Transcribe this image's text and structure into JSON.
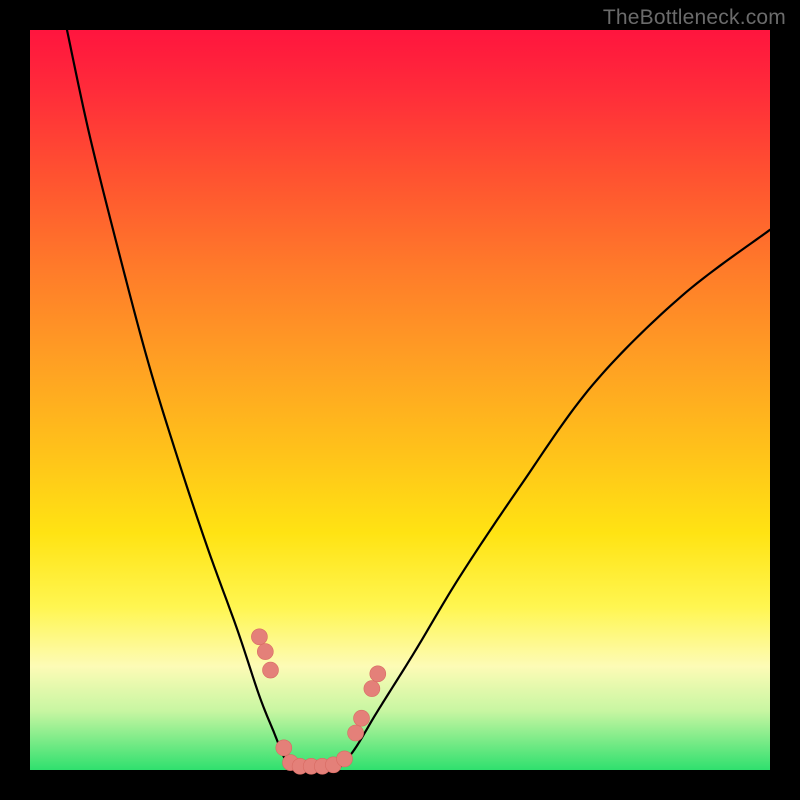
{
  "watermark": "TheBottleneck.com",
  "chart_data": {
    "type": "line",
    "title": "",
    "xlabel": "",
    "ylabel": "",
    "xlim": [
      0,
      100
    ],
    "ylim": [
      0,
      100
    ],
    "grid": false,
    "legend": false,
    "background_gradient": {
      "direction": "vertical",
      "stops": [
        {
          "pos": 0.0,
          "color": "#ff153e"
        },
        {
          "pos": 0.45,
          "color": "#ffa023"
        },
        {
          "pos": 0.78,
          "color": "#fff651"
        },
        {
          "pos": 1.0,
          "color": "#2fe06e"
        }
      ]
    },
    "series": [
      {
        "name": "left-curve",
        "x": [
          5,
          8,
          12,
          16,
          20,
          24,
          28,
          31,
          33,
          34.2,
          35
        ],
        "y": [
          100,
          86,
          70,
          55,
          42,
          30,
          19,
          10,
          5,
          2,
          0.5
        ]
      },
      {
        "name": "right-curve",
        "x": [
          42,
          44,
          47,
          52,
          58,
          66,
          76,
          88,
          100
        ],
        "y": [
          0.5,
          3,
          8,
          16,
          26,
          38,
          52,
          64,
          73
        ]
      },
      {
        "name": "flat-bottom",
        "x": [
          35,
          36.5,
          38,
          39.5,
          41,
          42
        ],
        "y": [
          0.5,
          0.3,
          0.3,
          0.3,
          0.3,
          0.5
        ]
      }
    ],
    "markers": [
      {
        "x": 31.0,
        "y": 18.0
      },
      {
        "x": 31.8,
        "y": 16.0
      },
      {
        "x": 32.5,
        "y": 13.5
      },
      {
        "x": 34.3,
        "y": 3.0
      },
      {
        "x": 35.2,
        "y": 1.0
      },
      {
        "x": 36.5,
        "y": 0.5
      },
      {
        "x": 38.0,
        "y": 0.5
      },
      {
        "x": 39.5,
        "y": 0.5
      },
      {
        "x": 41.0,
        "y": 0.7
      },
      {
        "x": 42.5,
        "y": 1.5
      },
      {
        "x": 44.0,
        "y": 5.0
      },
      {
        "x": 44.8,
        "y": 7.0
      },
      {
        "x": 46.2,
        "y": 11.0
      },
      {
        "x": 47.0,
        "y": 13.0
      }
    ],
    "marker_radius_px": 8
  }
}
